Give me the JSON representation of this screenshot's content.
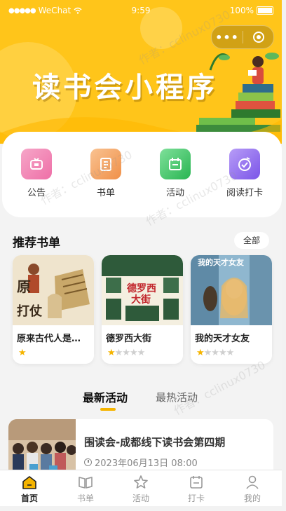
{
  "status_bar": {
    "carrier": "WeChat",
    "time": "9:59",
    "battery": "100%"
  },
  "hero": {
    "title": "读书会小程序"
  },
  "categories": [
    {
      "label": "公告",
      "icon": "announcement-icon",
      "color": "#f07fb0"
    },
    {
      "label": "书单",
      "icon": "booklist-icon",
      "color": "#f3a060"
    },
    {
      "label": "活动",
      "icon": "calendar-icon",
      "color": "#35c35f"
    },
    {
      "label": "阅读打卡",
      "icon": "checkin-icon",
      "color": "#9a6cf0"
    }
  ],
  "recommend": {
    "title": "推荐书单",
    "all_label": "全部",
    "books": [
      {
        "name": "原来古代人是这样打仗的",
        "rating": 1,
        "cover_text": "原来古代人是这样打仗的"
      },
      {
        "name": "德罗西大街",
        "rating": 1,
        "cover_text": "德罗西大街"
      },
      {
        "name": "我的天才女友",
        "rating": 1,
        "cover_text": "我的天才女友"
      }
    ]
  },
  "activity_tabs": {
    "latest": "最新活动",
    "hot": "最热活动"
  },
  "activities": [
    {
      "title": "围读会-成都线下读书会第四期",
      "time": "2023年06月13日 08:00"
    }
  ],
  "tabbar": [
    {
      "label": "首页",
      "icon": "home-icon",
      "active": true
    },
    {
      "label": "书单",
      "icon": "book-icon",
      "active": false
    },
    {
      "label": "活动",
      "icon": "star-icon",
      "active": false
    },
    {
      "label": "打卡",
      "icon": "checkin-calendar-icon",
      "active": false
    },
    {
      "label": "我的",
      "icon": "user-icon",
      "active": false
    }
  ],
  "watermark": "作者：cclinux0730"
}
